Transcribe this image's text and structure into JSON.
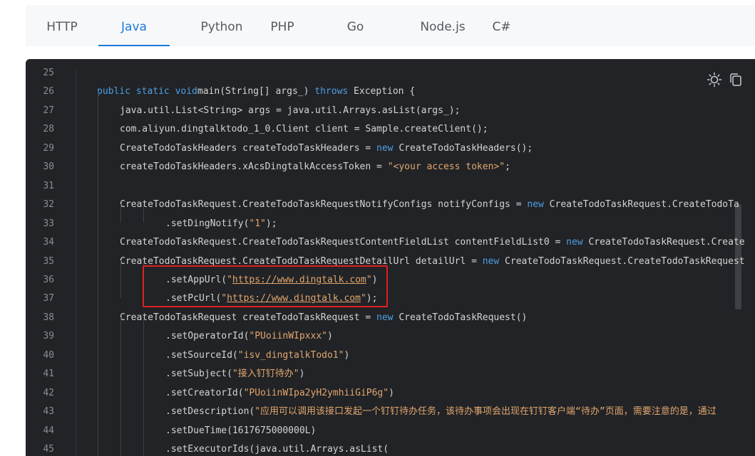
{
  "tabs": [
    "HTTP",
    "Java",
    "Python",
    "PHP",
    "Go",
    "Node.js",
    "C#"
  ],
  "active_tab": "Java",
  "toolbar": {
    "theme_icon": "sun-icon",
    "copy_icon": "copy-icon"
  },
  "colors": {
    "accent": "#1a7bd9",
    "code_bg": "#212326",
    "keyword": "#4e9ee6",
    "string": "#e2a66f",
    "highlight": "#e02020"
  },
  "lines": [
    {
      "n": "25",
      "p": []
    },
    {
      "n": "26",
      "p": [
        [
          "kw",
          "public static void"
        ],
        [
          "",
          "main(String[] args_) "
        ],
        [
          "kw",
          "throws"
        ],
        [
          "",
          " Exception {"
        ]
      ]
    },
    {
      "n": "27",
      "p": [
        [
          "",
          "java.util.List<String> args = java.util.Arrays.asList(args_);"
        ]
      ]
    },
    {
      "n": "28",
      "p": [
        [
          "",
          "com.aliyun.dingtalktodo_1_0.Client client = Sample.createClient();"
        ]
      ]
    },
    {
      "n": "29",
      "p": [
        [
          "",
          "CreateTodoTaskHeaders createTodoTaskHeaders = "
        ],
        [
          "kw",
          "new"
        ],
        [
          "",
          " CreateTodoTaskHeaders();"
        ]
      ]
    },
    {
      "n": "30",
      "p": [
        [
          "",
          "createTodoTaskHeaders.xAcsDingtalkAccessToken = "
        ],
        [
          "str",
          "\"<your access token>\""
        ],
        [
          "",
          ";"
        ]
      ]
    },
    {
      "n": "31",
      "p": []
    },
    {
      "n": "32",
      "p": [
        [
          "",
          "CreateTodoTaskRequest.CreateTodoTaskRequestNotifyConfigs notifyConfigs = "
        ],
        [
          "kw",
          "new"
        ],
        [
          "",
          " CreateTodoTaskRequest.CreateTodoTa"
        ]
      ]
    },
    {
      "n": "33",
      "p": [
        [
          "",
          ".setDingNotify("
        ],
        [
          "str",
          "\"1\""
        ],
        [
          "",
          ");"
        ]
      ]
    },
    {
      "n": "34",
      "p": [
        [
          "",
          "CreateTodoTaskRequest.CreateTodoTaskRequestContentFieldList contentFieldList0 = "
        ],
        [
          "kw",
          "new"
        ],
        [
          "",
          " CreateTodoTaskRequest.Create"
        ]
      ]
    },
    {
      "n": "35",
      "p": [
        [
          "",
          "CreateTodoTaskRequest.CreateTodoTaskRequestDetailUrl detailUrl = "
        ],
        [
          "kw",
          "new"
        ],
        [
          "",
          " CreateTodoTaskRequest.CreateTodoTaskRequest"
        ]
      ]
    },
    {
      "n": "36",
      "p": [
        [
          "",
          ".setAppUrl("
        ],
        [
          "str",
          "\""
        ],
        [
          "strl",
          "https://www.dingtalk.com"
        ],
        [
          "str",
          "\""
        ],
        [
          "",
          ")"
        ]
      ]
    },
    {
      "n": "37",
      "p": [
        [
          "",
          ".setPcUrl("
        ],
        [
          "str",
          "\""
        ],
        [
          "strl",
          "https://www.dingtalk.com"
        ],
        [
          "str",
          "\""
        ],
        [
          "",
          ");"
        ]
      ]
    },
    {
      "n": "38",
      "p": [
        [
          "",
          "CreateTodoTaskRequest createTodoTaskRequest = "
        ],
        [
          "kw",
          "new"
        ],
        [
          "",
          " CreateTodoTaskRequest()"
        ]
      ]
    },
    {
      "n": "39",
      "p": [
        [
          "",
          ".setOperatorId("
        ],
        [
          "str",
          "\"PUoiinWIpxxx\""
        ],
        [
          "",
          ")"
        ]
      ]
    },
    {
      "n": "40",
      "p": [
        [
          "",
          ".setSourceId("
        ],
        [
          "str",
          "\"isv_dingtalkTodo1\""
        ],
        [
          "",
          ")"
        ]
      ]
    },
    {
      "n": "41",
      "p": [
        [
          "",
          ".setSubject("
        ],
        [
          "str",
          "\"接入钉钉待办\""
        ],
        [
          "",
          ")"
        ]
      ]
    },
    {
      "n": "42",
      "p": [
        [
          "",
          ".setCreatorId("
        ],
        [
          "str",
          "\"PUoiinWIpa2yH2ymhiiGiP6g\""
        ],
        [
          "",
          ")"
        ]
      ]
    },
    {
      "n": "43",
      "p": [
        [
          "",
          ".setDescription("
        ],
        [
          "str",
          "\"应用可以调用该接口发起一个钉钉待办任务，该待办事项会出现在钉钉客户端“待办”页面，需要注意的是，通过"
        ]
      ]
    },
    {
      "n": "44",
      "p": [
        [
          "",
          ".setDueTime(1617675000000L)"
        ]
      ]
    },
    {
      "n": "45",
      "p": [
        [
          "",
          ".setExecutorIds(java.util.Arrays.asList("
        ]
      ]
    }
  ]
}
